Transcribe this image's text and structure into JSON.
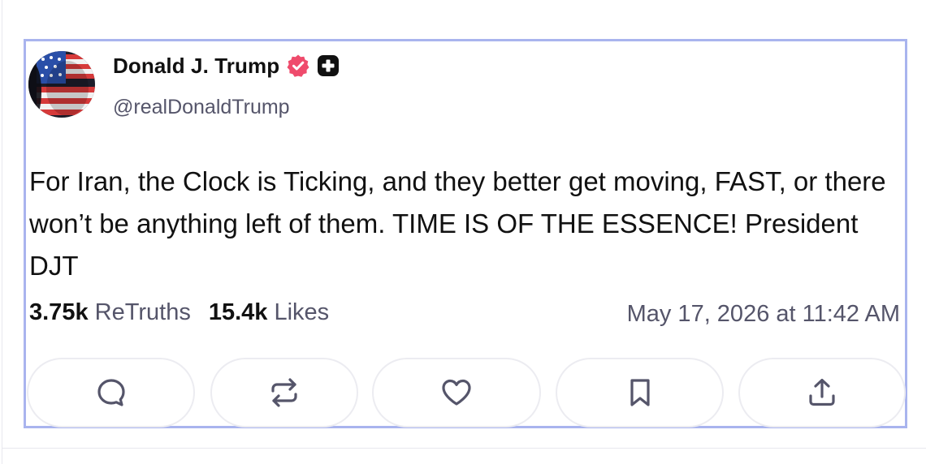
{
  "post": {
    "author": {
      "display_name": "Donald J. Trump",
      "handle": "@realDonaldTrump",
      "verified_icon": "verified-badge-icon",
      "extra_badge_icon": "plus-badge-icon"
    },
    "text": "For Iran, the Clock is Ticking, and they better get moving, FAST, or there won’t be anything left of them. TIME IS OF THE ESSENCE! President DJT",
    "stats": {
      "retruths_count": "3.75k",
      "retruths_label": "ReTruths",
      "likes_count": "15.4k",
      "likes_label": "Likes"
    },
    "timestamp": "May 17, 2026 at 11:42 AM"
  },
  "actions": [
    {
      "name": "reply",
      "icon": "comment-icon"
    },
    {
      "name": "retruth",
      "icon": "repost-icon"
    },
    {
      "name": "like",
      "icon": "heart-icon"
    },
    {
      "name": "bookmark",
      "icon": "bookmark-icon"
    },
    {
      "name": "share",
      "icon": "share-icon"
    }
  ],
  "colors": {
    "card_border": "#a9b4ee",
    "verified_badge": "#ef4b6c",
    "text_primary": "#111111",
    "text_secondary": "#55556a",
    "button_border": "#ececf1"
  }
}
